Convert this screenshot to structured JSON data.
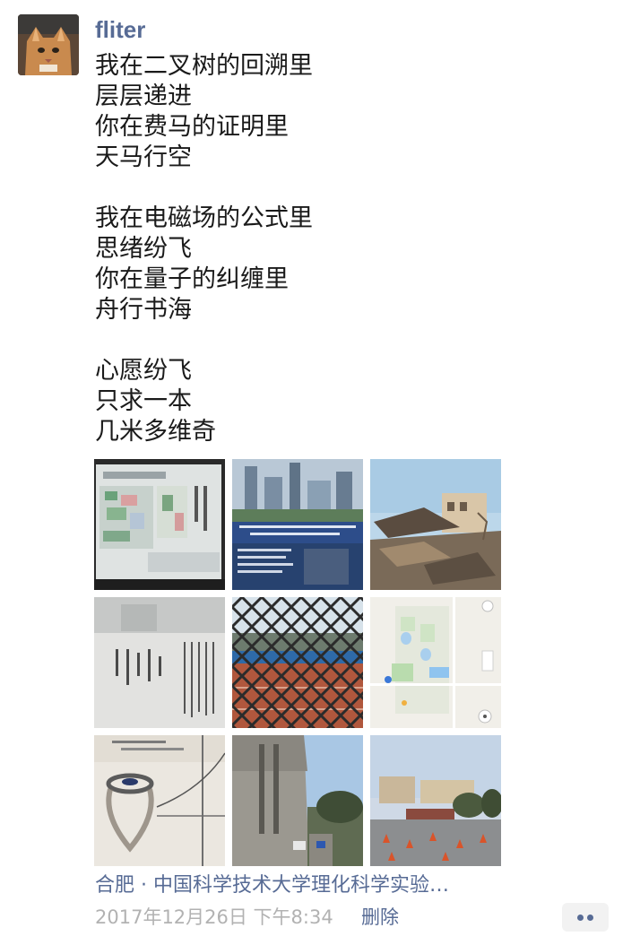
{
  "post": {
    "username": "fliter",
    "lines": [
      "我在二叉树的回溯里",
      "层层递进",
      "你在费马的证明里",
      "天马行空",
      "",
      "我在电磁场的公式里",
      "思绪纷飞",
      "你在量子的纠缠里",
      "舟行书海",
      "",
      "心愿纷飞",
      "只求一本",
      "几米多维奇"
    ],
    "photos": [
      {
        "name": "campus-map-board-photo"
      },
      {
        "name": "lecture-poster-photo"
      },
      {
        "name": "demolished-building-photo"
      },
      {
        "name": "inscription-stone-photo"
      },
      {
        "name": "fence-track-photo"
      },
      {
        "name": "map-screenshot-photo"
      },
      {
        "name": "ring-heart-shadow-photo"
      },
      {
        "name": "university-gate-photo"
      },
      {
        "name": "campus-square-photo"
      }
    ],
    "location": "合肥 · 中国科学技术大学理化科学实验…",
    "timestamp": "2017年12月26日 下午8:34",
    "delete_label": "删除",
    "more_icon": "more-dots-icon"
  }
}
